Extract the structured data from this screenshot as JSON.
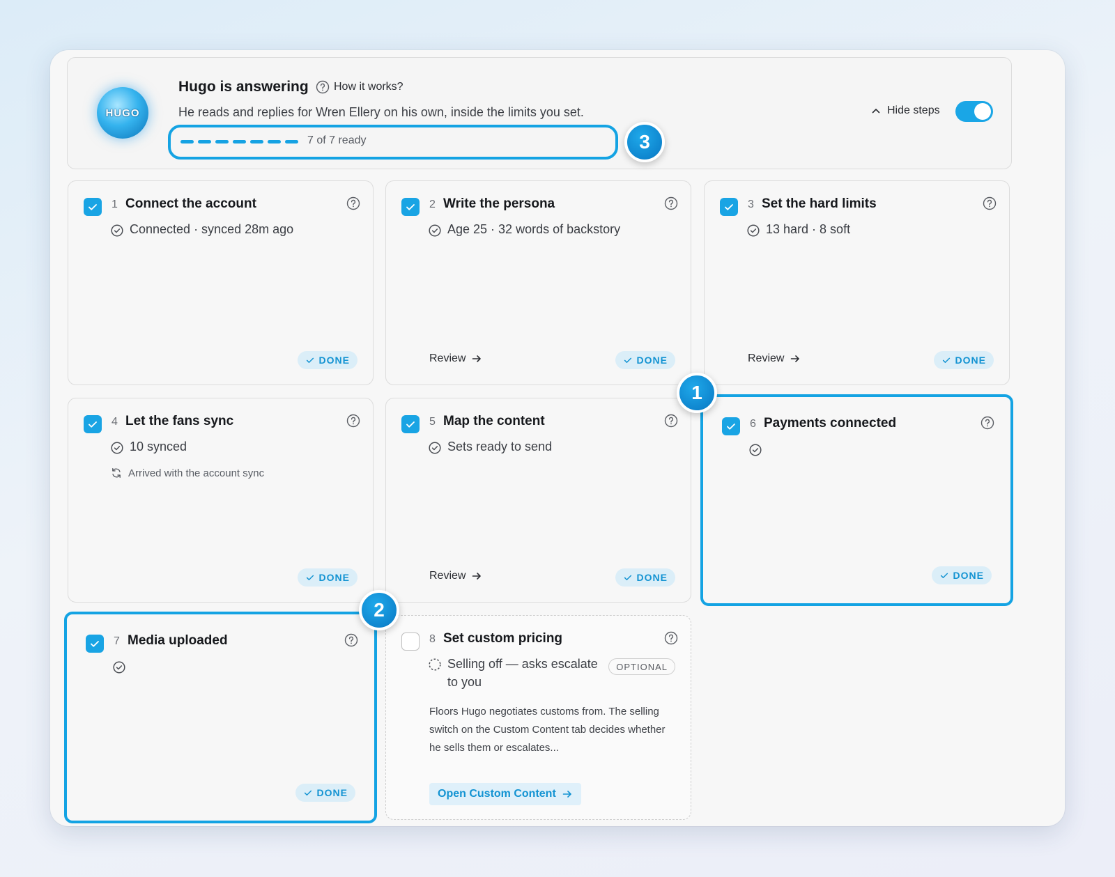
{
  "header": {
    "logo_text": "HUGO",
    "title": "Hugo is answering",
    "how_label": "How it works?",
    "subtitle": "He reads and replies for Wren Ellery on his own, inside the limits you set.",
    "progress_text": "7 of 7 ready",
    "progress": {
      "done": 7,
      "total": 7
    },
    "hide_steps_label": "Hide steps",
    "toggle_on": true
  },
  "markers": {
    "m1": "1",
    "m2": "2",
    "m3": "3"
  },
  "cards": [
    {
      "num": "1",
      "title": "Connect the account",
      "status": "Connected · synced 28m ago",
      "done": "DONE"
    },
    {
      "num": "2",
      "title": "Write the persona",
      "status": "Age 25 · 32 words of backstory",
      "review": "Review",
      "done": "DONE"
    },
    {
      "num": "3",
      "title": "Set the hard limits",
      "status": "13 hard · 8 soft",
      "review": "Review",
      "done": "DONE"
    },
    {
      "num": "4",
      "title": "Let the fans sync",
      "status": "10 synced",
      "sub": "Arrived with the account sync",
      "done": "DONE"
    },
    {
      "num": "5",
      "title": "Map the content",
      "status": "Sets ready to send",
      "review": "Review",
      "done": "DONE"
    },
    {
      "num": "6",
      "title": "Payments connected",
      "done": "DONE"
    },
    {
      "num": "7",
      "title": "Media uploaded",
      "done": "DONE"
    },
    {
      "num": "8",
      "title": "Set custom pricing",
      "status": "Selling off — asks escalate to you",
      "badge": "OPTIONAL",
      "desc": "Floors Hugo negotiates customs from. The selling switch on the Custom Content tab decides whether he sells them or escalates...",
      "button": "Open Custom Content"
    }
  ],
  "colors": {
    "accent": "#19a4e4",
    "done_bg": "#dbeef8",
    "done_text": "#1393d2"
  }
}
